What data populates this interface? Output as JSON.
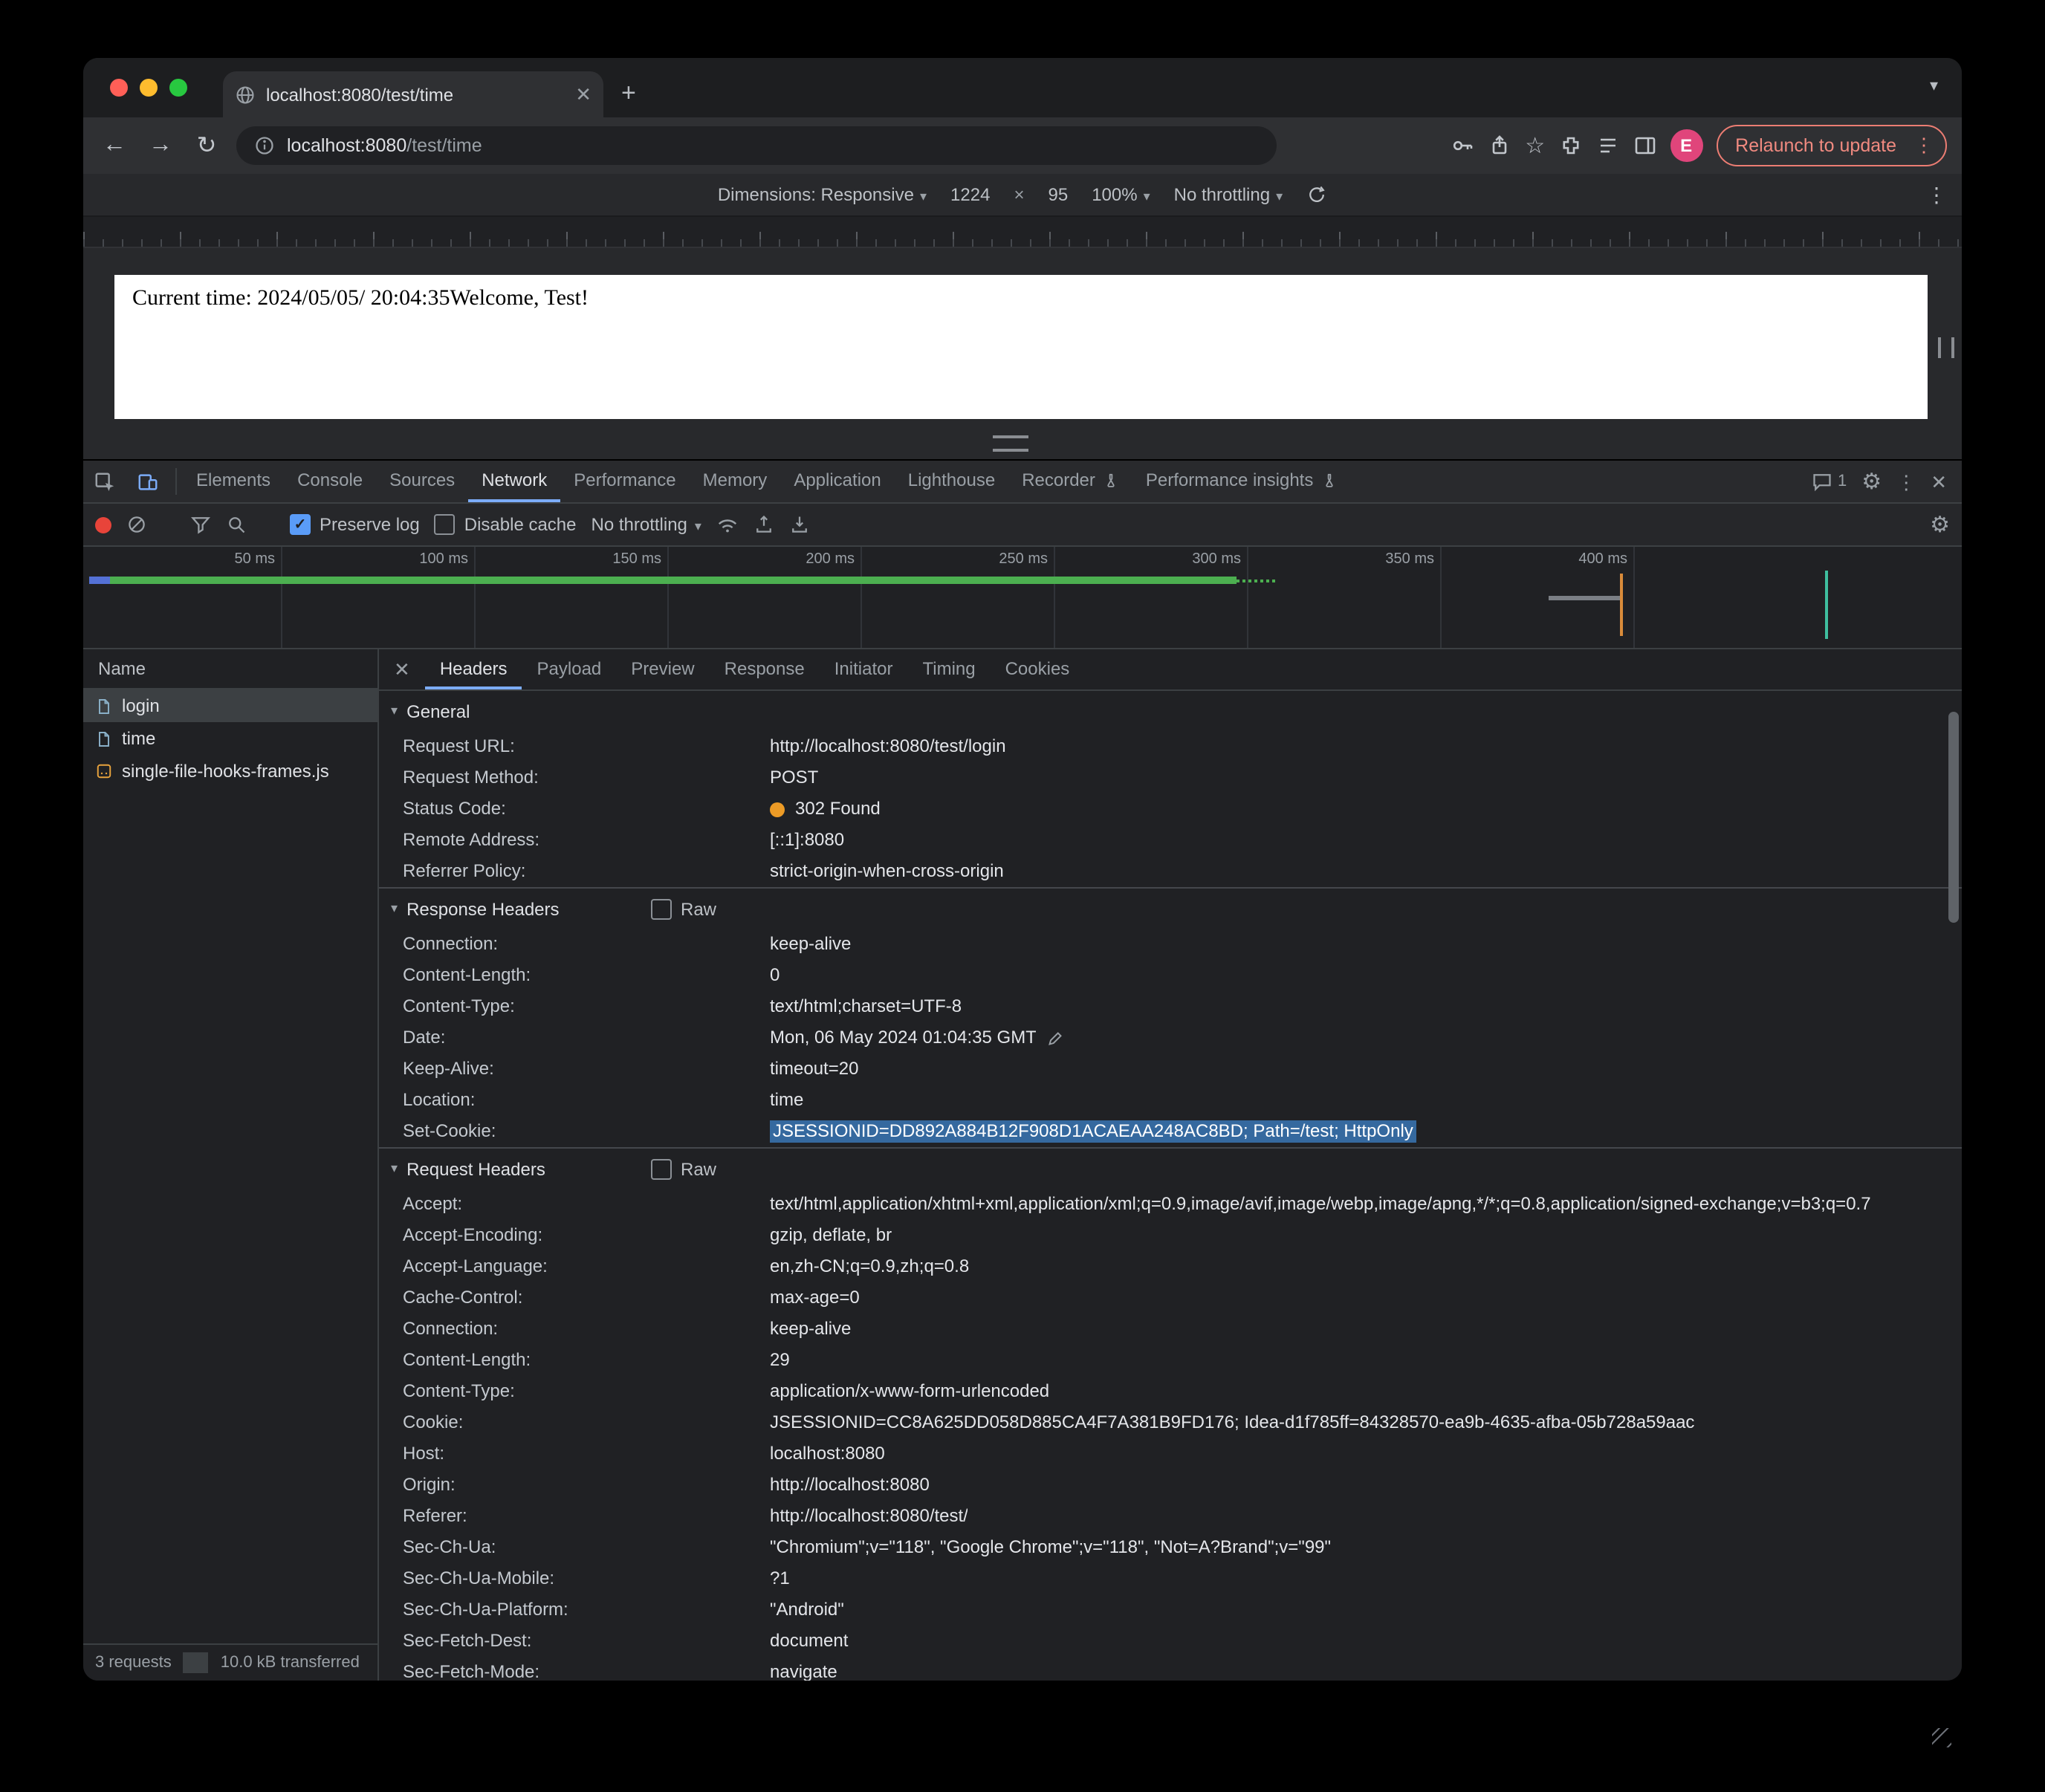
{
  "colors": {
    "accent_blue": "#7cacf8",
    "record_red": "#e8443a",
    "status_orange": "#ec9b26",
    "highlight_blue": "#35699f",
    "avatar_pink": "#e0457b",
    "relaunch_coral": "#f08a80"
  },
  "browser": {
    "tab_title": "localhost:8080/test/time",
    "url_host": "localhost:8080",
    "url_path": "/test/time",
    "relaunch_label": "Relaunch to update",
    "avatar_initial": "E"
  },
  "device_toolbar": {
    "dimensions_label": "Dimensions: Responsive",
    "width": "1224",
    "times": "×",
    "height": "95",
    "zoom": "100%",
    "throttle": "No throttling"
  },
  "page": {
    "content_text": "Current time: 2024/05/05/ 20:04:35Welcome, Test!"
  },
  "devtools": {
    "tabs": [
      {
        "label": "Elements"
      },
      {
        "label": "Console"
      },
      {
        "label": "Sources"
      },
      {
        "label": "Network",
        "active": true
      },
      {
        "label": "Performance"
      },
      {
        "label": "Memory"
      },
      {
        "label": "Application"
      },
      {
        "label": "Lighthouse"
      },
      {
        "label": "Recorder",
        "flask": true
      },
      {
        "label": "Performance insights",
        "flask": true
      }
    ],
    "badge_count": "1",
    "network_bar": {
      "preserve_log": "Preserve log",
      "disable_cache": "Disable cache",
      "throttling": "No throttling"
    },
    "timeline_labels": [
      "50 ms",
      "100 ms",
      "150 ms",
      "200 ms",
      "250 ms",
      "300 ms",
      "350 ms",
      "400 ms"
    ],
    "requests": {
      "header": "Name",
      "items": [
        {
          "label": "login",
          "doc": true,
          "selected": true
        },
        {
          "label": "time",
          "doc": true,
          "zebra": true
        },
        {
          "label": "single-file-hooks-frames.js",
          "js": true
        }
      ],
      "summary_requests": "3 requests",
      "summary_transferred": "10.0 kB transferred"
    },
    "detail_tabs": [
      {
        "label": "Headers",
        "active": true
      },
      {
        "label": "Payload"
      },
      {
        "label": "Preview"
      },
      {
        "label": "Response"
      },
      {
        "label": "Initiator"
      },
      {
        "label": "Timing"
      },
      {
        "label": "Cookies"
      }
    ],
    "sections": {
      "general": {
        "title": "General",
        "rows": [
          {
            "name": "Request URL:",
            "value": "http://localhost:8080/test/login"
          },
          {
            "name": "Request Method:",
            "value": "POST"
          },
          {
            "name": "Status Code:",
            "value": "302 Found",
            "dot": true
          },
          {
            "name": "Remote Address:",
            "value": "[::1]:8080"
          },
          {
            "name": "Referrer Policy:",
            "value": "strict-origin-when-cross-origin"
          }
        ]
      },
      "response_headers": {
        "title": "Response Headers",
        "raw_label": "Raw",
        "rows": [
          {
            "name": "Connection:",
            "value": "keep-alive"
          },
          {
            "name": "Content-Length:",
            "value": "0"
          },
          {
            "name": "Content-Type:",
            "value": "text/html;charset=UTF-8"
          },
          {
            "name": "Date:",
            "value": "Mon, 06 May 2024 01:04:35 GMT",
            "edit": true
          },
          {
            "name": "Keep-Alive:",
            "value": "timeout=20"
          },
          {
            "name": "Location:",
            "value": "time"
          },
          {
            "name": "Set-Cookie:",
            "value": "JSESSIONID=DD892A884B12F908D1ACAEAA248AC8BD; Path=/test; HttpOnly",
            "hl": true
          }
        ]
      },
      "request_headers": {
        "title": "Request Headers",
        "raw_label": "Raw",
        "rows": [
          {
            "name": "Accept:",
            "value": "text/html,application/xhtml+xml,application/xml;q=0.9,image/avif,image/webp,image/apng,*/*;q=0.8,application/signed-exchange;v=b3;q=0.7"
          },
          {
            "name": "Accept-Encoding:",
            "value": "gzip, deflate, br"
          },
          {
            "name": "Accept-Language:",
            "value": "en,zh-CN;q=0.9,zh;q=0.8"
          },
          {
            "name": "Cache-Control:",
            "value": "max-age=0"
          },
          {
            "name": "Connection:",
            "value": "keep-alive"
          },
          {
            "name": "Content-Length:",
            "value": "29"
          },
          {
            "name": "Content-Type:",
            "value": "application/x-www-form-urlencoded"
          },
          {
            "name": "Cookie:",
            "value": "JSESSIONID=CC8A625DD058D885CA4F7A381B9FD176; Idea-d1f785ff=84328570-ea9b-4635-afba-05b728a59aac"
          },
          {
            "name": "Host:",
            "value": "localhost:8080"
          },
          {
            "name": "Origin:",
            "value": "http://localhost:8080"
          },
          {
            "name": "Referer:",
            "value": "http://localhost:8080/test/"
          },
          {
            "name": "Sec-Ch-Ua:",
            "value": "\"Chromium\";v=\"118\", \"Google Chrome\";v=\"118\", \"Not=A?Brand\";v=\"99\""
          },
          {
            "name": "Sec-Ch-Ua-Mobile:",
            "value": "?1"
          },
          {
            "name": "Sec-Ch-Ua-Platform:",
            "value": "\"Android\""
          },
          {
            "name": "Sec-Fetch-Dest:",
            "value": "document"
          },
          {
            "name": "Sec-Fetch-Mode:",
            "value": "navigate"
          }
        ]
      }
    }
  }
}
